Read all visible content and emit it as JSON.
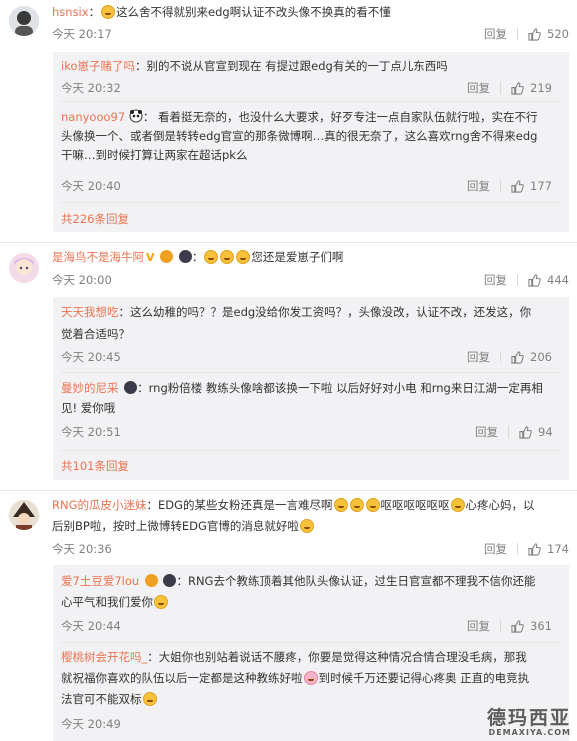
{
  "actions": {
    "reply_label": "回复"
  },
  "c1": {
    "user": "hsnsix",
    "text": "这么舍不得就别来edg啊认证不改头像不换真的看不懂",
    "time": "今天 20:17",
    "likes": "520",
    "replies": [
      {
        "user": "iko崽子赌了吗",
        "text": "别的不说从官宣到现在 有提过跟edg有关的一丁点儿东西吗",
        "time": "今天 20:32",
        "likes": "219"
      },
      {
        "user": "nanyooo97",
        "line1": "看着挺无奈的，也没什么大要求，好歹专注一点自家队伍就行啦，实在不行",
        "line2": "头像换一个、或者倒是转转edg官宣的那条微博啊…真的很无奈了，这么喜欢rng舍不得来edg",
        "line3": "干嘛…到时候打算让两家在超话pk么",
        "time": "今天 20:40",
        "likes": "177"
      }
    ],
    "more": "共226条回复"
  },
  "c2": {
    "user": "是海鸟不是海牛阿",
    "badge_v": "V",
    "text": "您还是爱崽子们啊",
    "time": "今天 20:00",
    "likes": "444",
    "replies": [
      {
        "user": "天天我想吃",
        "line1": "这么幼稚的吗？？是edg没给你发工资吗？，头像没改，认证不改，还发这，你",
        "line2": "觉着合适吗？",
        "time": "今天 20:45",
        "likes": "206"
      },
      {
        "user": "曼妙的尼采",
        "line1": "rng粉倍楼 教练头像啥都该换一下啦 以后好好对小电 和rng来日江湖一定再相",
        "line2": "见! 爱你哦",
        "time": "今天 20:51",
        "likes": "94"
      }
    ],
    "more": "共101条回复"
  },
  "c3": {
    "user": "RNG的瓜皮小迷妹",
    "line1a": "EDG的某些女粉还真是一言难尽啊",
    "line1b": "呕呕呕呕呕呕",
    "line1c": "心疼心妈，以",
    "line2": "后别BP啦，按时上微博转EDG官博的消息就好啦",
    "time": "今天 20:36",
    "likes": "174",
    "replies": [
      {
        "user": "爱7土豆爱7lou",
        "line1": "RNG去个教练顶着其他队头像认证，过生日官宣都不理我不信你还能",
        "line2": "心平气和我们爱你",
        "time": "今天 20:44",
        "likes": "361"
      },
      {
        "user": "樱桃树会开花吗_",
        "line1": "大姐你也别站着说话不腰疼，你要是觉得这种情况合情合理没毛病，那我",
        "line2a": "就祝福你喜欢的队伍以后一定都是这种教练好啦",
        "line2b": "到时候千万还要记得心疼奥 正直的电竞执",
        "line3": "法官可不能双标",
        "time": "今天 20:49"
      }
    ]
  },
  "watermark": {
    "cn": "德玛西亚",
    "en": "DEMAXIYA.COM"
  },
  "colors": {
    "name": "#eb7350",
    "meta": "#808080",
    "reply_bg": "#f2f2f5"
  }
}
